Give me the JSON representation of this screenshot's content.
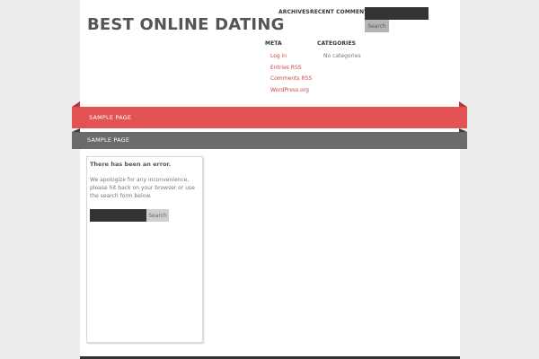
{
  "site": {
    "title": "BEST ONLINE DATING"
  },
  "widgets": {
    "archives_heading": "ARCHIVES",
    "recent_comments_heading": "RECENT COMMENTS",
    "search_button": "Search",
    "meta_heading": "META",
    "meta_links": [
      "Log in",
      "Entries RSS",
      "Comments RSS",
      "WordPress.org"
    ],
    "categories_heading": "CATEGORIES",
    "categories_empty": "No categories"
  },
  "nav": {
    "primary_item": "SAMPLE PAGE",
    "secondary_item": "SAMPLE PAGE"
  },
  "error": {
    "title": "There has been an error.",
    "message": "We apologize for any inconvenience, please hit back on your browser or use the search form below.",
    "search_button": "Search"
  },
  "colors": {
    "accent_red": "#e35353",
    "nav_gray": "#6b6b6b",
    "link_red": "#d0454a"
  }
}
